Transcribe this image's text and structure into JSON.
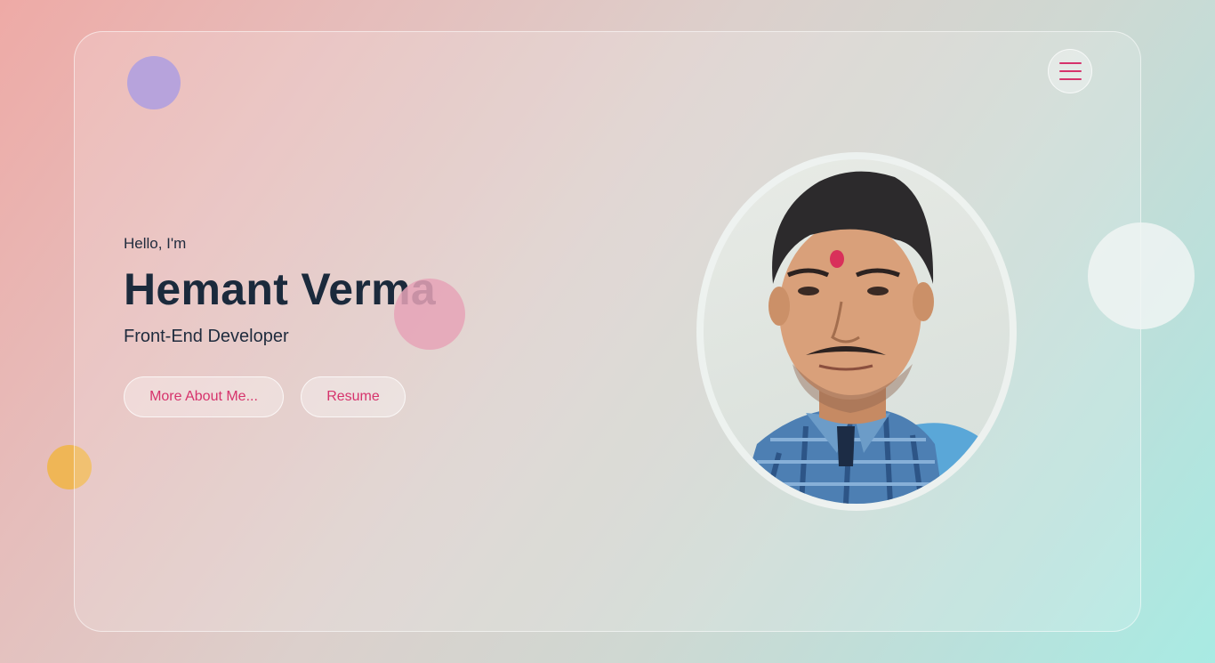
{
  "header": {
    "menu_icon": "hamburger-menu-icon"
  },
  "hero": {
    "greeting": "Hello, I'm",
    "name": "Hemant Verma",
    "role": "Front-End Developer",
    "buttons": {
      "more": "More About Me...",
      "resume": "Resume"
    }
  },
  "colors": {
    "accent": "#d6336c",
    "name_text": "#1b2a3c",
    "blob_purple": "#b7a3dc",
    "blob_pink": "#e6a3b7",
    "blob_orange": "#efb656"
  },
  "profile_image": {
    "shape": "oval"
  }
}
